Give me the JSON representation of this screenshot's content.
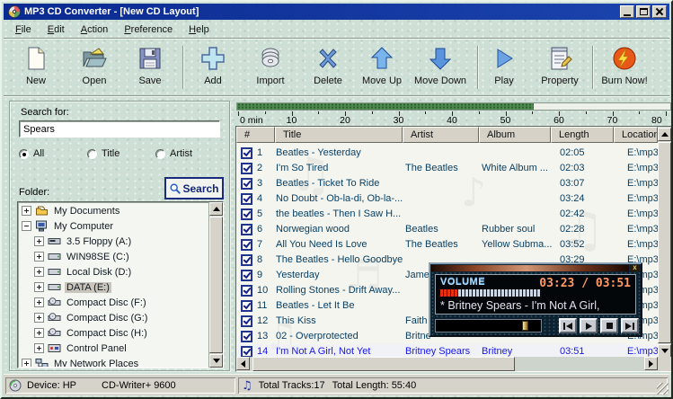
{
  "window": {
    "title": "MP3 CD Converter - [New CD Layout]"
  },
  "menu": {
    "items": [
      "File",
      "Edit",
      "Action",
      "Preference",
      "Help"
    ]
  },
  "toolbar": {
    "buttons": [
      "New",
      "Open",
      "Save",
      "Add",
      "Import",
      "Delete",
      "Move Up",
      "Move Down",
      "Play",
      "Property",
      "Burn Now!"
    ]
  },
  "sidebar": {
    "search_label": "Search for:",
    "search_value": "Spears",
    "radios": [
      {
        "label": "All",
        "selected": true
      },
      {
        "label": "Title",
        "selected": false
      },
      {
        "label": "Artist",
        "selected": false
      }
    ],
    "folder_label": "Folder:",
    "search_button": "Search",
    "tree": [
      {
        "label": "My Documents",
        "icon": "docs",
        "level": 0,
        "toggle": "plus",
        "selected": false
      },
      {
        "label": "My Computer",
        "icon": "computer",
        "level": 0,
        "toggle": "minus",
        "selected": false
      },
      {
        "label": "3.5 Floppy (A:)",
        "icon": "floppy",
        "level": 1,
        "toggle": "plus",
        "selected": false
      },
      {
        "label": "WIN98SE (C:)",
        "icon": "hdd",
        "level": 1,
        "toggle": "plus",
        "selected": false
      },
      {
        "label": "Local Disk (D:)",
        "icon": "hdd",
        "level": 1,
        "toggle": "plus",
        "selected": false
      },
      {
        "label": "DATA (E:)",
        "icon": "hdd",
        "level": 1,
        "toggle": "plus",
        "selected": true
      },
      {
        "label": "Compact Disc (F:)",
        "icon": "cd",
        "level": 1,
        "toggle": "plus",
        "selected": false
      },
      {
        "label": "Compact Disc (G:)",
        "icon": "cd",
        "level": 1,
        "toggle": "plus",
        "selected": false
      },
      {
        "label": "Compact Disc (H:)",
        "icon": "cd",
        "level": 1,
        "toggle": "plus",
        "selected": false
      },
      {
        "label": "Control Panel",
        "icon": "cpanel",
        "level": 1,
        "toggle": "plus",
        "selected": false
      },
      {
        "label": "My Network Places",
        "icon": "network",
        "level": 0,
        "toggle": "plus",
        "selected": false
      }
    ]
  },
  "ruler": {
    "labels": [
      "0 min",
      "10",
      "20",
      "30",
      "40",
      "50",
      "60",
      "70",
      "80"
    ],
    "capacity_fraction": 0.685
  },
  "list": {
    "columns": [
      "#",
      "Title",
      "Artist",
      "Album",
      "Length",
      "Location"
    ],
    "tracks": [
      {
        "num": "1",
        "title": "Beatles - Yesterday",
        "artist": "",
        "album": "",
        "length": "02:05",
        "location": "E:\\mp3\\",
        "checked": true,
        "highlighted": false
      },
      {
        "num": "2",
        "title": "I'm So Tired",
        "artist": "The Beatles",
        "album": "White Album ...",
        "length": "02:03",
        "location": "E:\\mp3\\",
        "checked": true,
        "highlighted": false
      },
      {
        "num": "3",
        "title": "Beatles -  Ticket To Ride",
        "artist": "",
        "album": "",
        "length": "03:07",
        "location": "E:\\mp3\\",
        "checked": true,
        "highlighted": false
      },
      {
        "num": "4",
        "title": "No Doubt - Ob-la-di, Ob-la-...",
        "artist": "",
        "album": "",
        "length": "03:24",
        "location": "E:\\mp3\\",
        "checked": true,
        "highlighted": false
      },
      {
        "num": "5",
        "title": "the beatles - Then I Saw H...",
        "artist": "",
        "album": "",
        "length": "02:42",
        "location": "E:\\mp3\\",
        "checked": true,
        "highlighted": false
      },
      {
        "num": "6",
        "title": "Norwegian wood",
        "artist": "Beatles",
        "album": "Rubber soul",
        "length": "02:28",
        "location": "E:\\mp3\\",
        "checked": true,
        "highlighted": false
      },
      {
        "num": "7",
        "title": "All You Need Is Love",
        "artist": "The Beatles",
        "album": "Yellow Subma...",
        "length": "03:52",
        "location": "E:\\mp3\\",
        "checked": true,
        "highlighted": false
      },
      {
        "num": "8",
        "title": "The Beatles - Hello Goodbye",
        "artist": "",
        "album": "",
        "length": "03:29",
        "location": "E:\\mp3\\",
        "checked": true,
        "highlighted": false
      },
      {
        "num": "9",
        "title": "Yesterday",
        "artist": "Jame",
        "album": "",
        "length": "",
        "location": "E:\\mp3\\",
        "checked": true,
        "highlighted": false
      },
      {
        "num": "10",
        "title": "Rolling Stones - Drift Away...",
        "artist": "",
        "album": "",
        "length": "",
        "location": "E:\\mp3\\",
        "checked": true,
        "highlighted": false
      },
      {
        "num": "11",
        "title": "Beatles - Let It Be",
        "artist": "",
        "album": "",
        "length": "",
        "location": "E:\\mp3\\",
        "checked": true,
        "highlighted": false
      },
      {
        "num": "12",
        "title": "This Kiss",
        "artist": "Faith",
        "album": "",
        "length": "",
        "location": "E:\\mp3\\",
        "checked": true,
        "highlighted": false
      },
      {
        "num": "13",
        "title": "02 - Overprotected",
        "artist": "Britne",
        "album": "",
        "length": "",
        "location": "E:\\mp3\\",
        "checked": true,
        "highlighted": false
      },
      {
        "num": "14",
        "title": "I'm Not A Girl, Not Yet",
        "artist": "Britney Spears",
        "album": "Britney",
        "length": "03:51",
        "location": "E:\\mp3\\",
        "checked": true,
        "highlighted": true
      }
    ]
  },
  "player": {
    "volume_label": "VOLUME",
    "time": "03:23 / 03:51",
    "track_text": "* Britney Spears - I'm Not A Girl,",
    "volume_segments": 28,
    "volume_red": 5,
    "close_glyph": "x"
  },
  "statusbar": {
    "device_label": "Device: HP",
    "device_name": "CD-Writer+ 9600",
    "total_tracks": "Total Tracks:17",
    "total_length": "Total Length: 55:40",
    "notes_icon": "♫"
  },
  "colors": {
    "titlebar": "#0c2e9c",
    "capacity_fill": "#4e8a4e",
    "row_text": "#0a4066",
    "highlighted_row_text": "#1717e8",
    "time_text": "#ff9a66"
  }
}
